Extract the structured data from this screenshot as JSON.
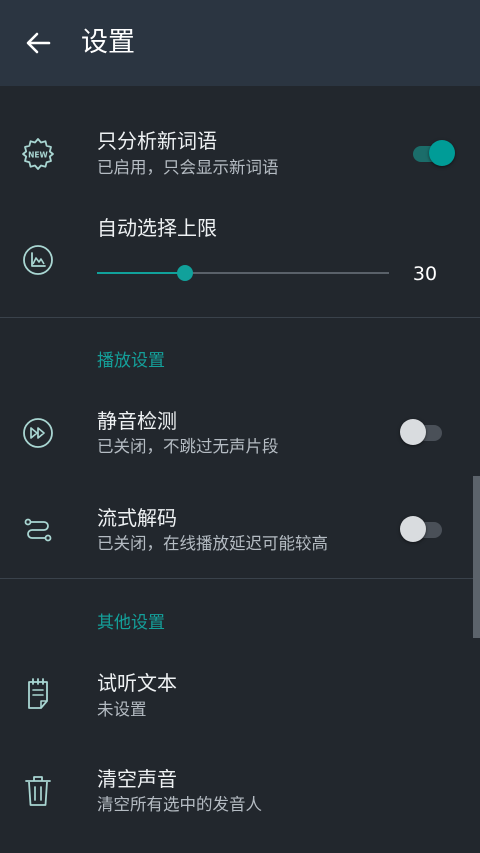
{
  "appbar": {
    "title": "设置",
    "back_icon": "arrow-left-icon"
  },
  "colors": {
    "accent": "#11a19b",
    "background": "#22272d",
    "appbar": "#2b3541"
  },
  "rows": {
    "new_words": {
      "title": "只分析新词语",
      "subtitle": "已启用，只会显示新词语",
      "icon": "new-badge-icon",
      "enabled": true
    },
    "auto_select": {
      "title": "自动选择上限",
      "icon": "chart-icon",
      "value": "30",
      "fraction": 0.3
    },
    "silence_detect": {
      "title": "静音检测",
      "subtitle": "已关闭，不跳过无声片段",
      "icon": "fast-forward-icon",
      "enabled": false
    },
    "streaming": {
      "title": "流式解码",
      "subtitle": "已关闭，在线播放延迟可能较高",
      "icon": "route-icon",
      "enabled": false
    },
    "preview_text": {
      "title": "试听文本",
      "subtitle": "未设置",
      "icon": "notepad-icon"
    },
    "clear_voices": {
      "title": "清空声音",
      "subtitle": "清空所有选中的发音人",
      "icon": "trash-icon"
    }
  },
  "sections": {
    "playback": "播放设置",
    "other": "其他设置"
  }
}
